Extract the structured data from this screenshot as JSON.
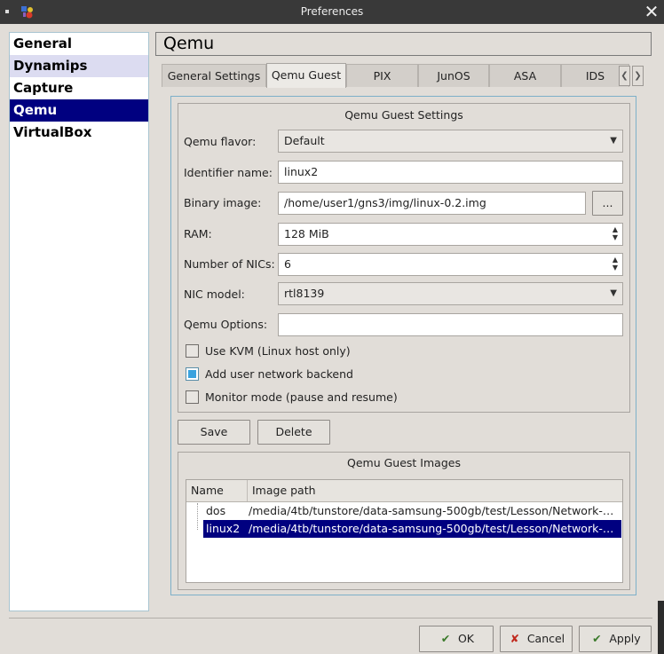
{
  "window": {
    "title": "Preferences"
  },
  "categories": [
    {
      "label": "General"
    },
    {
      "label": "Dynamips"
    },
    {
      "label": "Capture"
    },
    {
      "label": "Qemu"
    },
    {
      "label": "VirtualBox"
    }
  ],
  "header": {
    "title": "Qemu"
  },
  "tabs": [
    {
      "label": "General Settings"
    },
    {
      "label": "Qemu Guest"
    },
    {
      "label": "PIX"
    },
    {
      "label": "JunOS"
    },
    {
      "label": "ASA"
    },
    {
      "label": "IDS"
    }
  ],
  "guest_settings": {
    "title": "Qemu Guest Settings",
    "flavor": {
      "label": "Qemu flavor:",
      "value": "Default"
    },
    "identifier": {
      "label": "Identifier name:",
      "value": "linux2"
    },
    "binary": {
      "label": "Binary image:",
      "value": "/home/user1/gns3/img/linux-0.2.img",
      "browse": "..."
    },
    "ram": {
      "label": "RAM:",
      "value": "128 MiB"
    },
    "nics": {
      "label": "Number of NICs:",
      "value": "6"
    },
    "nic_model": {
      "label": "NIC model:",
      "value": "rtl8139"
    },
    "options": {
      "label": "Qemu Options:",
      "value": ""
    },
    "kvm": {
      "label": "Use KVM (Linux host only)",
      "checked": false
    },
    "user_net": {
      "label": "Add user network backend",
      "checked": true
    },
    "monitor": {
      "label": "Monitor mode (pause and resume)",
      "checked": false
    }
  },
  "actions": {
    "save": "Save",
    "delete": "Delete"
  },
  "images": {
    "title": "Qemu Guest Images",
    "columns": [
      "Name",
      "Image path"
    ],
    "rows": [
      {
        "name": "dos",
        "path": "/media/4tb/tunstore/data-samsung-500gb/test/Lesson/Network-Co..."
      },
      {
        "name": "linux2",
        "path": "/media/4tb/tunstore/data-samsung-500gb/test/Lesson/Network-Co..."
      }
    ],
    "selected_row": "linux2"
  },
  "dialog_buttons": {
    "ok": "OK",
    "cancel": "Cancel",
    "apply": "Apply"
  },
  "colors": {
    "selection": "#000080",
    "alt_row": "#dcdcf1",
    "titlebar": "#393939"
  }
}
